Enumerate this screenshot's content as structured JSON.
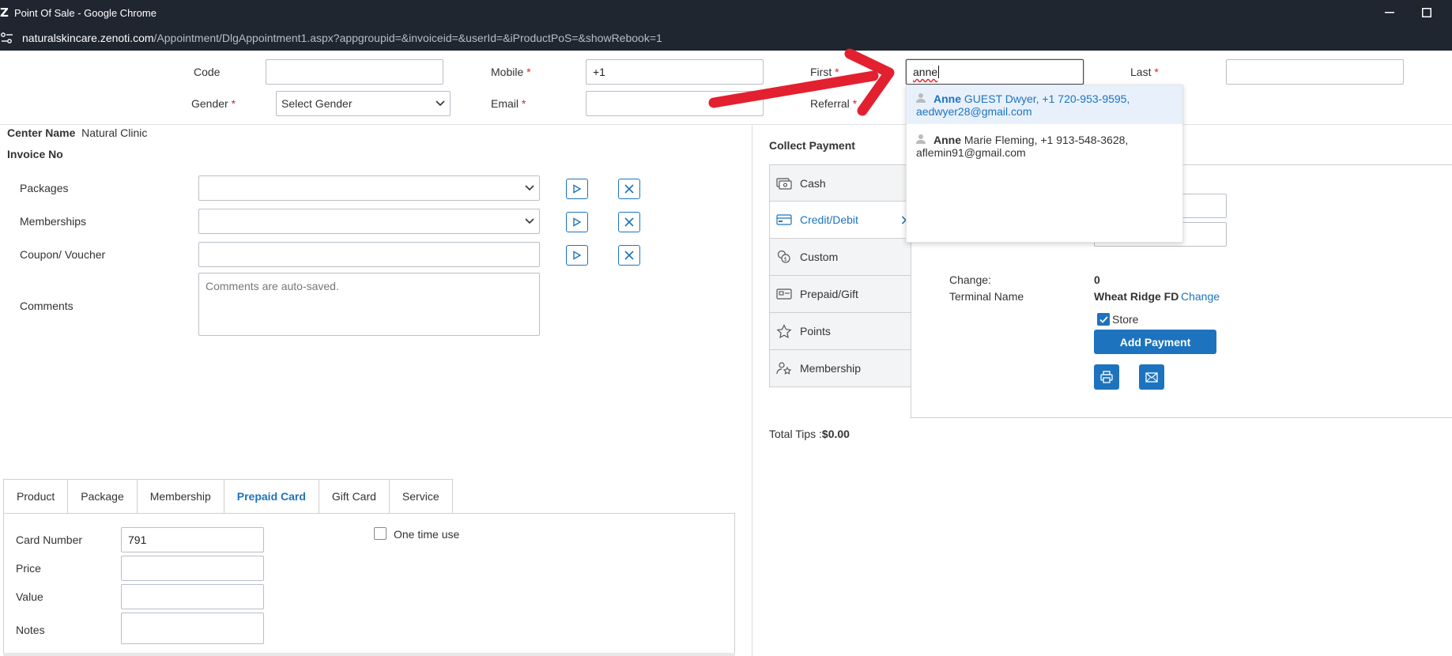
{
  "window": {
    "title": "Point Of Sale - Google Chrome",
    "url_host": "naturalskincare.zenoti.com",
    "url_path": "/Appointment/DlgAppointment1.aspx?appgroupid=&invoiceid=&userId=&iProductPoS=&showRebook=1"
  },
  "guest": {
    "code_label": "Code",
    "code_value": "",
    "mobile_label": "Mobile",
    "mobile_value": "+1",
    "first_label": "First",
    "first_value": "anne",
    "last_label": "Last",
    "last_value": "",
    "gender_label": "Gender",
    "gender_value": "Select Gender",
    "email_label": "Email",
    "email_value": "",
    "referral_label": "Referral",
    "required_mark": "*"
  },
  "suggestions": [
    {
      "first": "Anne",
      "rest": " GUEST Dwyer, +1 720-953-9595,",
      "email": "aedwyer28@gmail.com"
    },
    {
      "first": "Anne",
      "rest": " Marie Fleming, +1 913-548-3628,",
      "email": "aflemin91@gmail.com"
    }
  ],
  "invoice": {
    "center_label": "Center Name",
    "center_value": "Natural Clinic",
    "invoice_label": "Invoice No",
    "packages_label": "Packages",
    "memberships_label": "Memberships",
    "coupon_label": "Coupon/ Voucher",
    "comments_label": "Comments",
    "comments_placeholder": "Comments are auto-saved."
  },
  "tabs": [
    "Product",
    "Package",
    "Membership",
    "Prepaid Card",
    "Gift Card",
    "Service"
  ],
  "prepaid": {
    "card_number_label": "Card Number",
    "card_number_value": "791",
    "price_label": "Price",
    "value_label": "Value",
    "notes_label": "Notes",
    "one_time_label": "One time use"
  },
  "payment": {
    "title": "Collect Payment",
    "methods": [
      "Cash",
      "Credit/Debit",
      "Custom",
      "Prepaid/Gift",
      "Points",
      "Membership"
    ],
    "change_label": "Change:",
    "change_value": "0",
    "terminal_label": "Terminal Name",
    "terminal_value": "Wheat Ridge FD",
    "terminal_change_link": "Change",
    "store_label": "Store",
    "add_payment_label": "Add Payment",
    "total_tips_label": "Total Tips :",
    "total_tips_value": "$0.00"
  },
  "colors": {
    "accent": "#1e73be",
    "required": "#d9232d",
    "annotation_arrow": "#e3202f"
  }
}
